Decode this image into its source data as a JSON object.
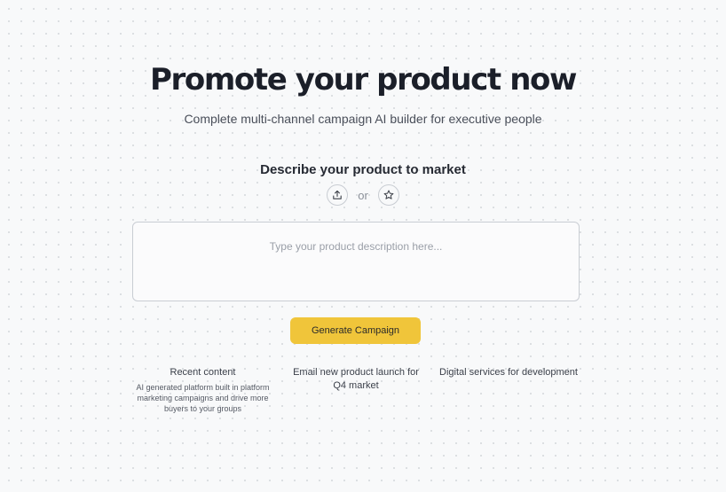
{
  "hero": {
    "title": "Promote your product now",
    "subtitle": "Complete multi-channel campaign AI builder for executive people"
  },
  "describe": {
    "heading": "Describe your product to market",
    "upload_icon": "upload-icon",
    "or_label": "or",
    "star_icon": "star-icon"
  },
  "description_input": {
    "value": "",
    "placeholder": "Type your product description here..."
  },
  "generate_button": {
    "label": "Generate Campaign"
  },
  "suggestions": [
    {
      "title": "Recent content",
      "description": "AI generated platform built in platform marketing campaigns and drive more buyers to your groups"
    },
    {
      "title": "Email new product launch for Q4 market"
    },
    {
      "title": "Digital services for development"
    }
  ],
  "colors": {
    "accent": "#f0c53a",
    "background": "#f8f9fa",
    "text": "#1b1f29"
  }
}
